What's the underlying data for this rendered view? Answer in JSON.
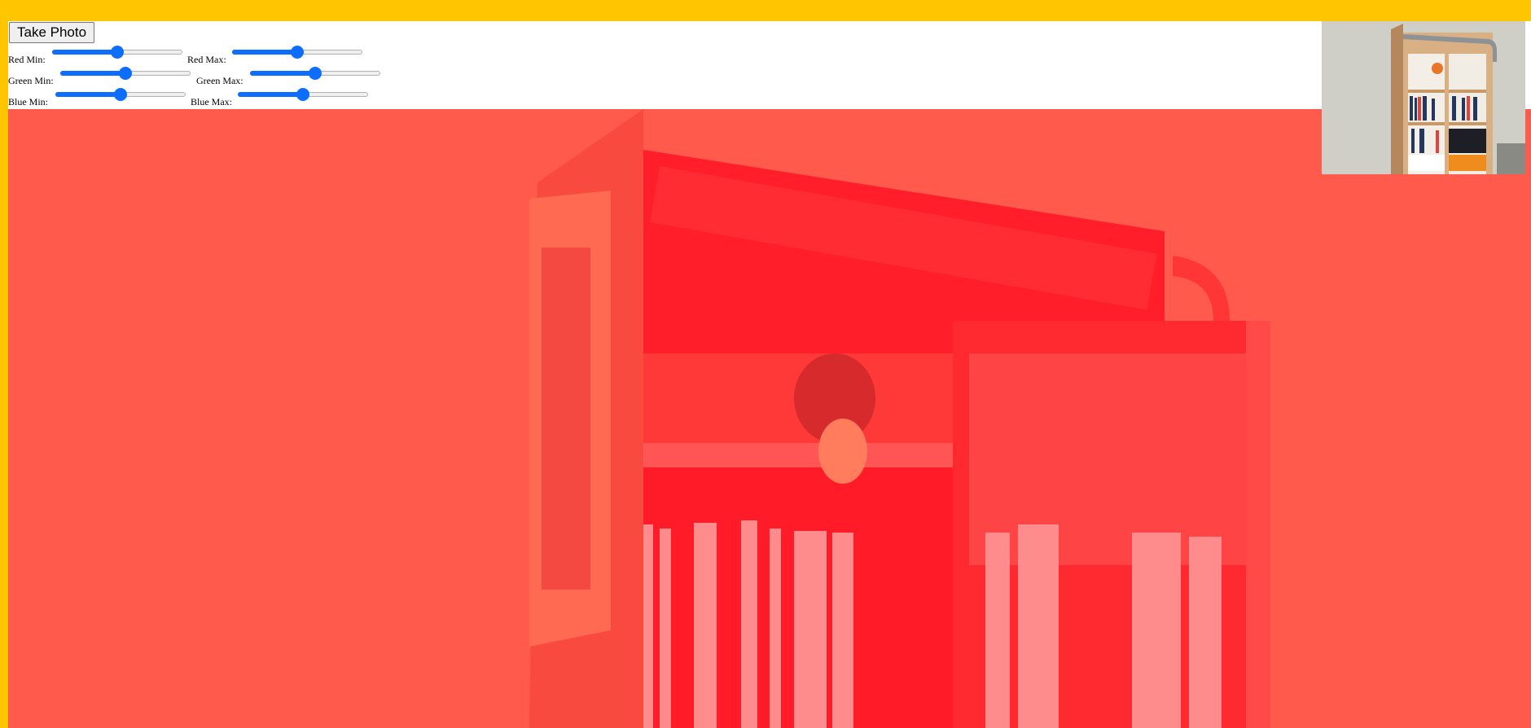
{
  "controls": {
    "take_photo_label": "Take Photo",
    "sliders": [
      {
        "label": "Red Min:",
        "value": 0.5
      },
      {
        "label": "Red Max:",
        "value": 0.5
      },
      {
        "label": "Green Min:",
        "value": 0.5
      },
      {
        "label": "Green Max:",
        "value": 0.5
      },
      {
        "label": "Blue Min:",
        "value": 0.5
      },
      {
        "label": "Blue Max:",
        "value": 0.5
      }
    ]
  },
  "colors": {
    "page_background": "#ffc600",
    "slider_accent": "#0d6efd",
    "video_tint": "#ff5a4b"
  }
}
